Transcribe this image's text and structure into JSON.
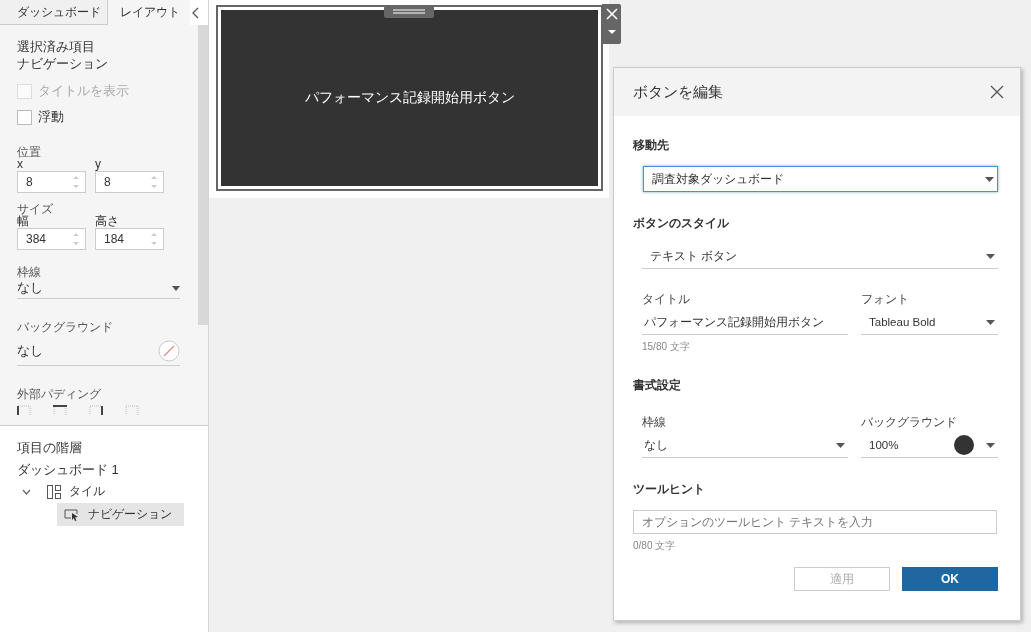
{
  "sidebar": {
    "tabs": [
      {
        "label": "ダッシュボード",
        "selected": false
      },
      {
        "label": "レイアウト",
        "selected": true
      }
    ],
    "selected_item": {
      "heading": "選択済み項目",
      "name": "ナビゲーション"
    },
    "checkboxes": [
      {
        "label": "タイトルを表示",
        "checked": false,
        "disabled": true
      },
      {
        "label": "浮動",
        "checked": false,
        "disabled": false
      }
    ],
    "position": {
      "label": "位置",
      "fields": [
        {
          "label": "x",
          "value": "8"
        },
        {
          "label": "y",
          "value": "8"
        }
      ]
    },
    "size": {
      "label": "サイズ",
      "fields": [
        {
          "label": "幅",
          "value": "384"
        },
        {
          "label": "高さ",
          "value": "184"
        }
      ]
    },
    "border": {
      "label": "枠線",
      "value": "なし"
    },
    "background": {
      "label": "バックグラウンド",
      "value": "なし"
    },
    "outer_padding": {
      "label": "外部パディング"
    },
    "hierarchy": {
      "title": "項目の階層",
      "items": [
        {
          "label": "ダッシュボード 1",
          "children": [
            {
              "label": "タイル",
              "kind": "tiled",
              "expanded": true,
              "children": [
                {
                  "label": "ナビゲーション",
                  "kind": "navigation",
                  "selected": true
                }
              ]
            }
          ]
        }
      ]
    }
  },
  "canvas": {
    "button_text": "パフォーマンス記録開始用ボタン"
  },
  "dialog": {
    "title": "ボタンを編集",
    "destination": {
      "label": "移動先",
      "value": "調査対象ダッシュボード"
    },
    "button_style": {
      "label": "ボタンのスタイル",
      "value": "テキスト ボタン",
      "title_label": "タイトル",
      "title_value": "パフォーマンス記録開始用ボタン",
      "font_label": "フォント",
      "font_value": "Tableau Bold",
      "count": "15/80 文字"
    },
    "formatting": {
      "label": "書式設定",
      "border_label": "枠線",
      "border_value": "なし",
      "background_label": "バックグラウンド",
      "background_value": "100%"
    },
    "tooltip": {
      "label": "ツールヒント",
      "placeholder": "オプションのツールヒント テキストを入力",
      "count": "0/80 文字"
    },
    "buttons": [
      {
        "label": "適用",
        "disabled": true,
        "kind": "secondary"
      },
      {
        "label": "OK",
        "disabled": false,
        "kind": "primary"
      }
    ]
  }
}
